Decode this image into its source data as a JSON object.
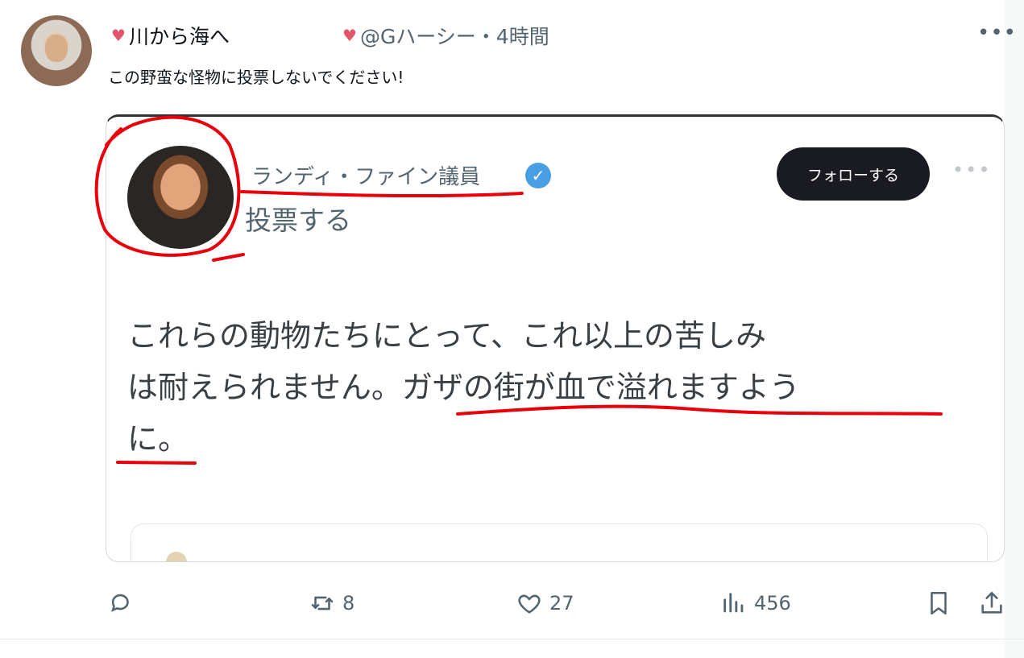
{
  "post": {
    "author_name": "川から海へ",
    "handle_time": "@Gハーシー・4時間",
    "heart_glyph": "♥",
    "text": "この野蛮な怪物に投票しないでください!",
    "more_label": "•••"
  },
  "quoted": {
    "name": "ランディ・ファイン議員",
    "subtitle": "投票する",
    "follow_label": "フォローする",
    "more_label": "•••",
    "body_line1": "これらの動物たちにとって、これ以上の苦しみ",
    "body_line2": "は耐えられません。ガザの街が血で溢れますよう",
    "body_line3": "に。"
  },
  "actions": {
    "reply_count": "",
    "repost_count": "8",
    "like_count": "27",
    "views_count": "456"
  },
  "colors": {
    "annotation": "#e8000b",
    "heart": "#e0556a",
    "verified": "#4a9ee3",
    "follow_button": "#1a1b22"
  }
}
